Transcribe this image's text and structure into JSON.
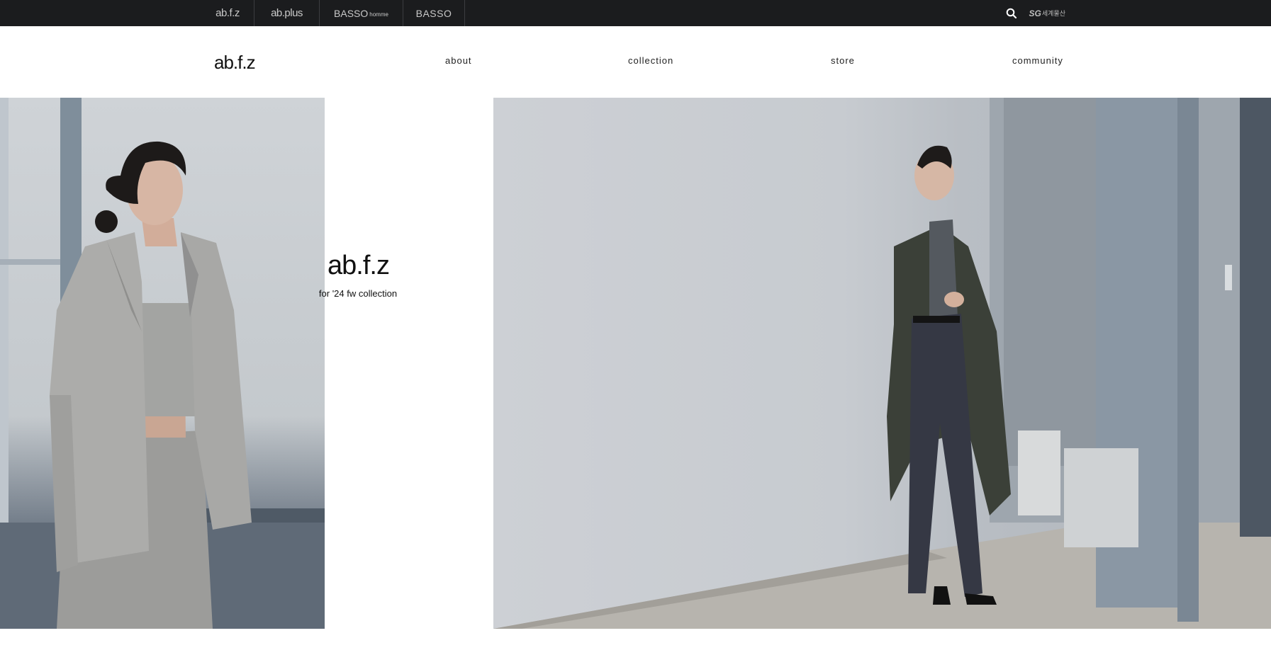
{
  "topbar": {
    "brands": [
      "ab.f.z",
      "ab.plus",
      "BASSO",
      "BASSO"
    ],
    "basso_homme_suffix": "homme",
    "sg_logo": "SG",
    "sg_logo_korean": "세계물산",
    "search_icon": "search-icon"
  },
  "header": {
    "logo": "ab.f.z",
    "nav": [
      "about",
      "collection",
      "store",
      "community"
    ]
  },
  "hero": {
    "title": "ab.f.z",
    "subtitle": "for '24 fw collection"
  },
  "colors": {
    "topbar_bg": "#1b1c1e",
    "topbar_text": "#c9c9c9",
    "header_bg": "#ffffff",
    "text": "#111111"
  }
}
